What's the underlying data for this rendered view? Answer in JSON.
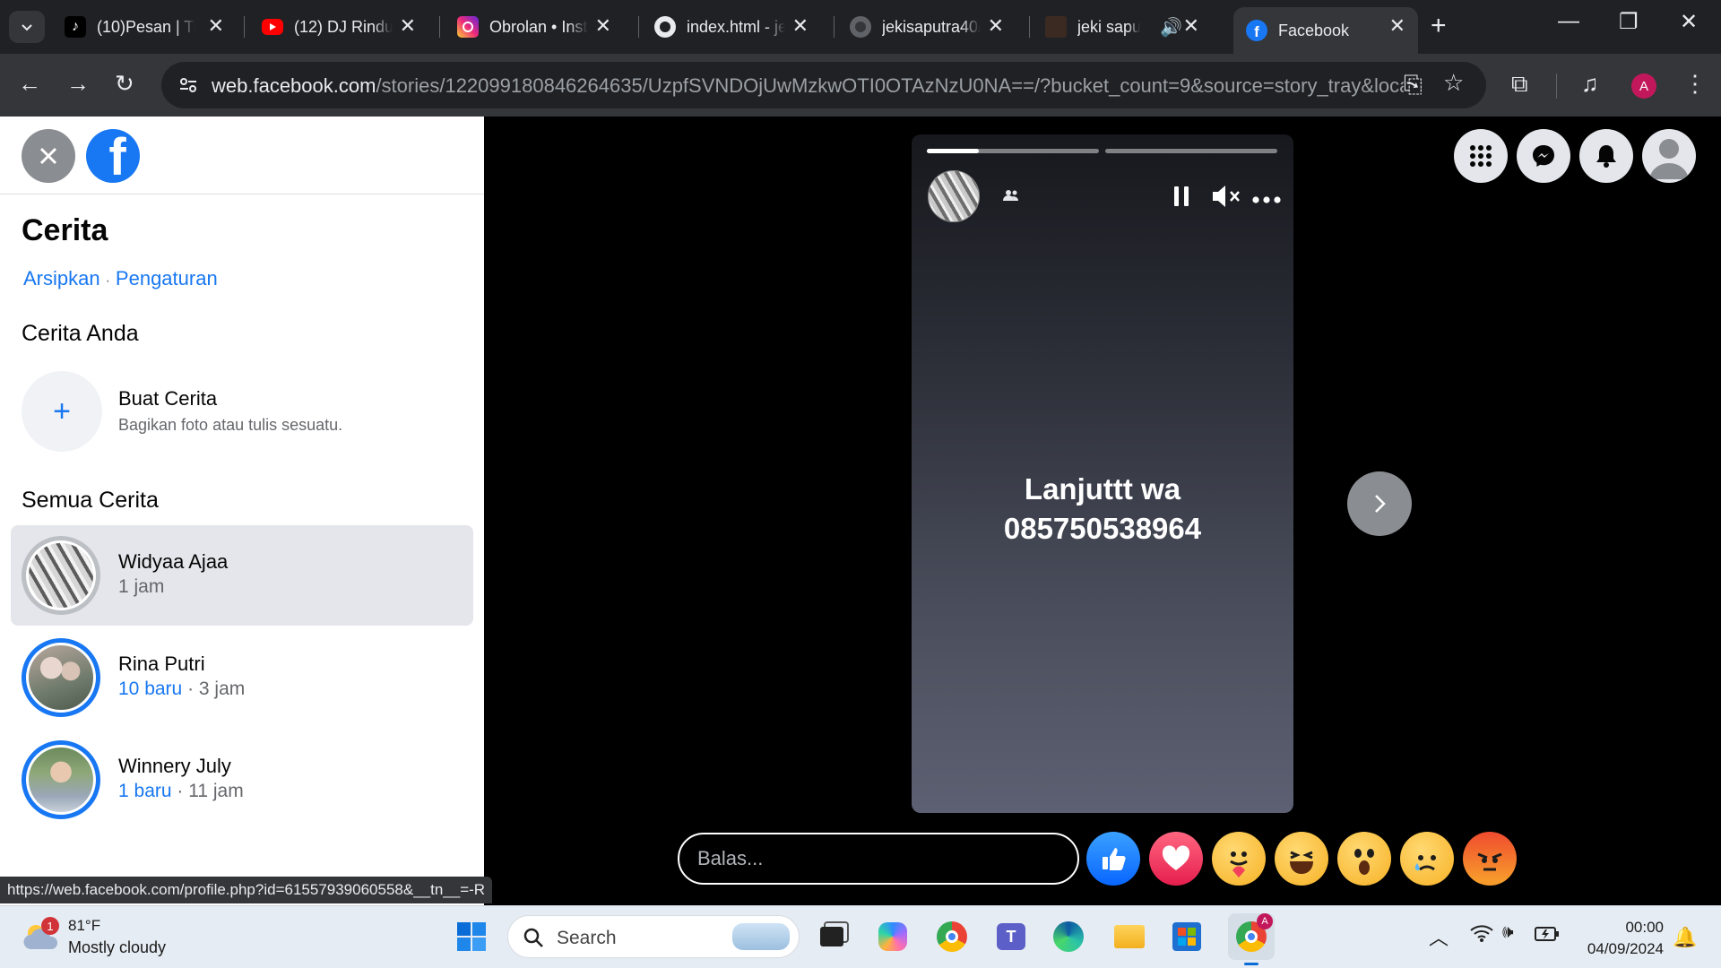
{
  "browser": {
    "tabs": [
      {
        "title": "(10)Pesan | TikTok",
        "icon": "tiktok-icon"
      },
      {
        "title": "(12) DJ Rindu",
        "icon": "youtube-icon"
      },
      {
        "title": "Obrolan • Instagram",
        "icon": "instagram-icon"
      },
      {
        "title": "index.html - je",
        "icon": "github-icon"
      },
      {
        "title": "jekisaputra40/",
        "icon": "github-icon"
      },
      {
        "title": "jeki saputra",
        "icon": "channel-icon"
      },
      {
        "title": "Facebook",
        "icon": "facebook-icon"
      }
    ],
    "url_host": "web.facebook.com",
    "url_path": "/stories/122099180846264635/UzpfSVNDOjUwMzkwOTI0OTAzNzU0NA==/?bucket_count=9&source=story_tray&locale=...",
    "profile_initial": "A",
    "status_link": "https://web.facebook.com/profile.php?id=61557939060558&__tn__=-R"
  },
  "sidebar": {
    "title": "Cerita",
    "archive_link": "Arsipkan",
    "separator": "·",
    "settings_link": "Pengaturan",
    "your_story_heading": "Cerita Anda",
    "create_title": "Buat Cerita",
    "create_subtitle": "Bagikan foto atau tulis sesuatu.",
    "all_stories_heading": "Semua Cerita",
    "stories": [
      {
        "name": "Widyaa Ajaa",
        "new_label": "",
        "time": "1 jam"
      },
      {
        "name": "Rina Putri",
        "new_label": "10 baru",
        "time": " · 3 jam"
      },
      {
        "name": "Winnery July",
        "new_label": "1 baru",
        "time": " · 11 jam"
      }
    ]
  },
  "story": {
    "text_line1": "Lanjuttt wa",
    "text_line2": "085750538964",
    "progress": [
      0.3,
      0,
      0
    ],
    "reply_placeholder": "Balas..."
  },
  "reactions": [
    "like",
    "love",
    "care",
    "haha",
    "wow",
    "sad",
    "angry"
  ],
  "taskbar": {
    "weather_badge": "1",
    "weather_temp": "81°F",
    "weather_desc": "Mostly cloudy",
    "search_label": "Search",
    "time": "00:00",
    "date": "04/09/2024"
  },
  "colors": {
    "fb_blue": "#1877f2",
    "chrome_dark": "#202124"
  }
}
